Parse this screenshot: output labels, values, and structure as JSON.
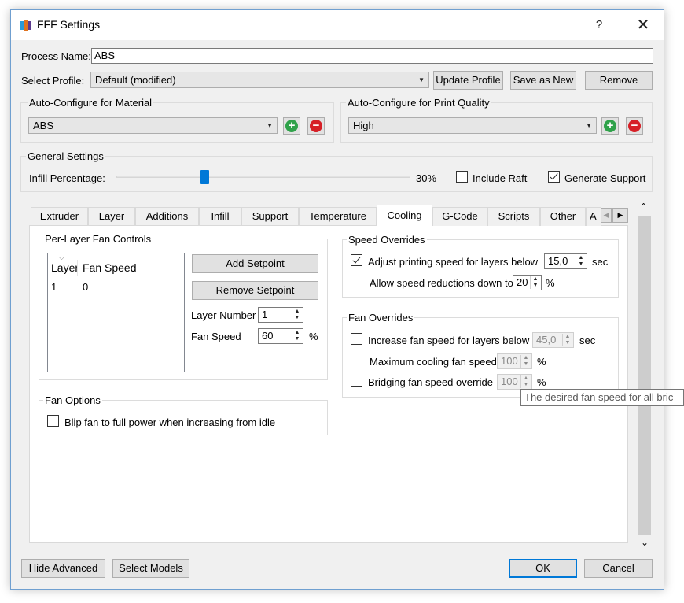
{
  "window": {
    "title": "FFF Settings",
    "help": "?",
    "close": "✕"
  },
  "process": {
    "label": "Process Name:",
    "value": "ABS"
  },
  "profile": {
    "label": "Select Profile:",
    "value": "Default (modified)",
    "update": "Update Profile",
    "save_as_new": "Save as New",
    "remove": "Remove"
  },
  "material": {
    "title": "Auto-Configure for Material",
    "value": "ABS",
    "add": "+",
    "remove": "−"
  },
  "quality": {
    "title": "Auto-Configure for Print Quality",
    "value": "High",
    "add": "+",
    "remove": "−"
  },
  "general": {
    "title": "General Settings",
    "infill_label": "Infill Percentage:",
    "infill_value": "30%",
    "infill_fraction": 0.3,
    "include_raft": {
      "label": "Include Raft",
      "checked": false
    },
    "generate_support": {
      "label": "Generate Support",
      "checked": true
    }
  },
  "tabs": [
    "Extruder",
    "Layer",
    "Additions",
    "Infill",
    "Support",
    "Temperature",
    "Cooling",
    "G-Code",
    "Scripts",
    "Other",
    "A"
  ],
  "active_tab": "Cooling",
  "fan_controls": {
    "title": "Per-Layer Fan Controls",
    "col_layer": "Layer",
    "col_speed": "Fan Speed",
    "rows": [
      {
        "layer": "1",
        "speed": "0"
      }
    ],
    "add_setpoint": "Add Setpoint",
    "remove_setpoint": "Remove Setpoint",
    "layer_number_label": "Layer Number",
    "layer_number_value": "1",
    "fan_speed_label": "Fan Speed",
    "fan_speed_value": "60",
    "fan_speed_unit": "%"
  },
  "fan_options": {
    "title": "Fan Options",
    "blip": {
      "label": "Blip fan to full power when increasing from idle",
      "checked": false
    }
  },
  "speed_overrides": {
    "title": "Speed Overrides",
    "adjust": {
      "label": "Adjust printing speed for layers below",
      "checked": true,
      "value": "15,0",
      "unit": "sec"
    },
    "allow": {
      "label": "Allow speed reductions down to",
      "value": "20",
      "unit": "%"
    }
  },
  "fan_overrides": {
    "title": "Fan Overrides",
    "increase": {
      "label": "Increase fan speed for layers below",
      "checked": false,
      "value": "45,0",
      "unit": "sec"
    },
    "max_cooling": {
      "label": "Maximum cooling fan speed",
      "value": "100",
      "unit": "%"
    },
    "bridging": {
      "label": "Bridging fan speed override",
      "checked": false,
      "value": "100",
      "unit": "%"
    }
  },
  "tooltip": "The desired fan speed for all bric",
  "footer": {
    "hide_advanced": "Hide Advanced",
    "select_models": "Select Models",
    "ok": "OK",
    "cancel": "Cancel"
  },
  "colors": {
    "accent": "#0078d7",
    "add": "#2fa24a",
    "remove": "#d61f26"
  }
}
